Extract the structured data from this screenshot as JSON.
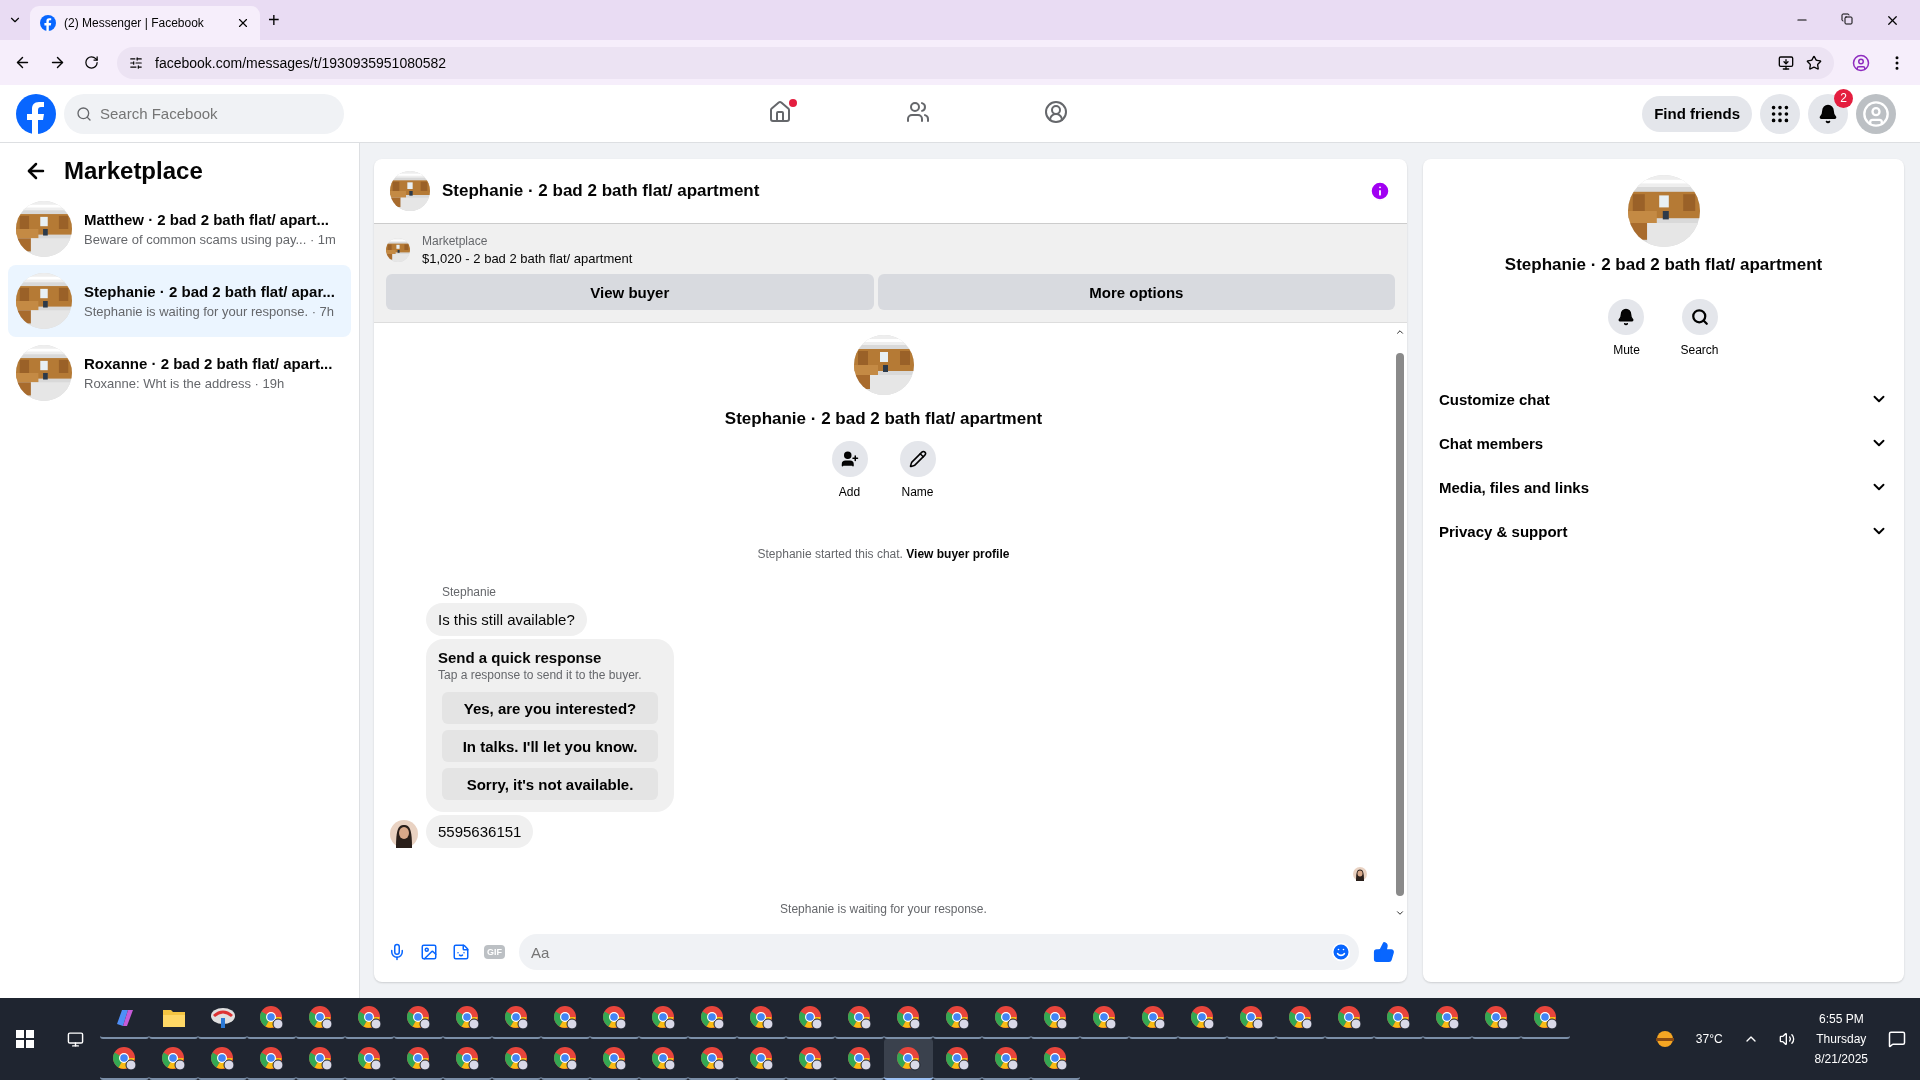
{
  "browser": {
    "tab": {
      "title": "(2) Messenger | Facebook",
      "selected": true
    },
    "new_tab": "+",
    "url": "facebook.com/messages/t/1930935951080582"
  },
  "top_nav": {
    "search": {
      "placeholder": "Search Facebook"
    },
    "nav_items": [
      {
        "kind": "home",
        "selected": false,
        "notification_dot": true
      },
      {
        "kind": "friends",
        "selected": false,
        "notification_dot": false
      },
      {
        "kind": "groups",
        "selected": false,
        "notification_dot": false
      }
    ],
    "find_friends": "Find friends",
    "notification_count": "2"
  },
  "sidebar": {
    "title": "Marketplace",
    "conversations": [
      {
        "name": "Matthew · 2 bad 2 bath flat/ apart...",
        "preview": "Beware of common scams using pay...  · 1m",
        "selected": false
      },
      {
        "name": "Stephanie · 2 bad 2 bath flat/ apar...",
        "preview": "Stephanie is waiting for your response. · 7h",
        "selected": true
      },
      {
        "name": "Roxanne · 2 bad 2 bath flat/ apart...",
        "preview": "Roxanne: Wht is the address · 19h",
        "selected": false
      }
    ]
  },
  "chat": {
    "title": "Stephanie · 2 bad 2 bath flat/ apartment",
    "listing": {
      "label": "Marketplace",
      "price_title": "$1,020 - 2 bad 2 bath flat/ apartment",
      "buttons": [
        "View buyer",
        "More options"
      ]
    },
    "intro": {
      "title": "Stephanie · 2 bad 2 bath flat/ apartment",
      "actions": [
        {
          "kind": "add",
          "label": "Add"
        },
        {
          "kind": "name",
          "label": "Name"
        }
      ],
      "started": "Stephanie started this chat.",
      "profile_link": "View buyer profile"
    },
    "sender": "Stephanie",
    "messages": [
      {
        "kind": "text",
        "text": "Is this still available?",
        "avatar": false
      },
      {
        "kind": "quick_responses",
        "title": "Send a quick response",
        "hint": "Tap a response to send it to the buyer.",
        "options": [
          "Yes, are you interested?",
          "In talks. I'll let you know.",
          "Sorry, it's not available."
        ]
      },
      {
        "kind": "text",
        "text": "5595636151",
        "avatar": true
      }
    ],
    "status": "Stephanie is waiting for your response.",
    "composer": {
      "gif": "GIF",
      "placeholder": "Aa"
    }
  },
  "details": {
    "title": "Stephanie · 2 bad 2 bath flat/ apartment",
    "actions": [
      {
        "kind": "mute",
        "label": "Mute"
      },
      {
        "kind": "search",
        "label": "Search"
      }
    ],
    "sections": [
      {
        "label": "Customize chat",
        "expanded": false
      },
      {
        "label": "Chat members",
        "expanded": false
      },
      {
        "label": "Media, files and links",
        "expanded": false
      },
      {
        "label": "Privacy & support",
        "expanded": false
      }
    ]
  },
  "taskbar": {
    "row_1": [
      {
        "kind": "copilot",
        "selected": false
      },
      {
        "kind": "explorer",
        "selected": false
      },
      {
        "kind": "app",
        "selected": false
      },
      {
        "kind": "browser",
        "selected": false
      },
      {
        "kind": "browser",
        "selected": false
      },
      {
        "kind": "browser",
        "selected": false
      },
      {
        "kind": "browser",
        "selected": false
      },
      {
        "kind": "browser",
        "selected": false
      },
      {
        "kind": "browser",
        "selected": false
      },
      {
        "kind": "browser",
        "selected": false
      },
      {
        "kind": "browser",
        "selected": false
      },
      {
        "kind": "browser",
        "selected": false
      },
      {
        "kind": "browser",
        "selected": false
      },
      {
        "kind": "browser",
        "selected": false
      },
      {
        "kind": "browser",
        "selected": false
      },
      {
        "kind": "browser",
        "selected": false
      },
      {
        "kind": "browser",
        "selected": false
      },
      {
        "kind": "browser",
        "selected": false
      },
      {
        "kind": "browser",
        "selected": false
      },
      {
        "kind": "browser",
        "selected": false
      },
      {
        "kind": "browser",
        "selected": false
      },
      {
        "kind": "browser",
        "selected": false
      },
      {
        "kind": "browser",
        "selected": false
      },
      {
        "kind": "browser",
        "selected": false
      },
      {
        "kind": "browser",
        "selected": false
      },
      {
        "kind": "browser",
        "selected": false
      },
      {
        "kind": "browser",
        "selected": false
      },
      {
        "kind": "browser",
        "selected": false
      },
      {
        "kind": "browser",
        "selected": false
      },
      {
        "kind": "browser",
        "selected": false
      }
    ],
    "row_2": [
      {
        "kind": "browser",
        "selected": false
      },
      {
        "kind": "browser",
        "selected": false
      },
      {
        "kind": "browser",
        "selected": false
      },
      {
        "kind": "browser",
        "selected": false
      },
      {
        "kind": "browser",
        "selected": false
      },
      {
        "kind": "browser",
        "selected": false
      },
      {
        "kind": "browser",
        "selected": false
      },
      {
        "kind": "browser",
        "selected": false
      },
      {
        "kind": "browser",
        "selected": false
      },
      {
        "kind": "browser",
        "selected": false
      },
      {
        "kind": "browser",
        "selected": false
      },
      {
        "kind": "browser",
        "selected": false
      },
      {
        "kind": "browser",
        "selected": false
      },
      {
        "kind": "browser",
        "selected": false
      },
      {
        "kind": "browser",
        "selected": false
      },
      {
        "kind": "browser",
        "selected": false
      },
      {
        "kind": "browser",
        "selected": true
      },
      {
        "kind": "browser",
        "selected": false
      },
      {
        "kind": "browser",
        "selected": false
      },
      {
        "kind": "browser",
        "selected": false
      }
    ],
    "weather": "37°C",
    "time": "6:55 PM",
    "day": "Thursday",
    "date": "8/21/2025"
  }
}
